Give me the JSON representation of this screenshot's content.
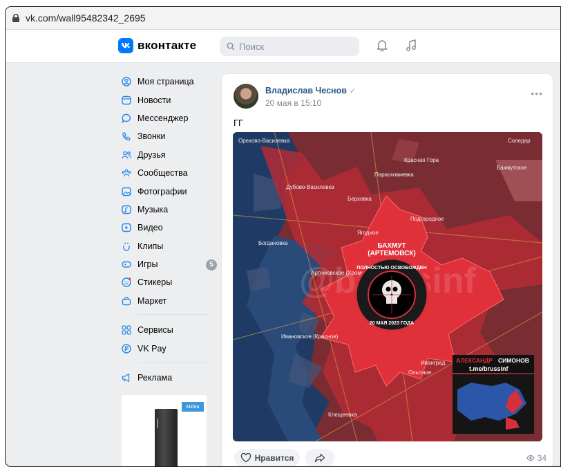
{
  "browser": {
    "url": "vk.com/wall95482342_2695"
  },
  "header": {
    "logo_text": "вконтакте",
    "search_placeholder": "Поиск"
  },
  "sidebar": {
    "items": [
      {
        "label": "Моя страница",
        "icon": "user-circle-icon"
      },
      {
        "label": "Новости",
        "icon": "news-icon"
      },
      {
        "label": "Мессенджер",
        "icon": "message-icon"
      },
      {
        "label": "Звонки",
        "icon": "phone-icon"
      },
      {
        "label": "Друзья",
        "icon": "friends-icon"
      },
      {
        "label": "Сообщества",
        "icon": "communities-icon"
      },
      {
        "label": "Фотографии",
        "icon": "photo-icon"
      },
      {
        "label": "Музыка",
        "icon": "music-icon"
      },
      {
        "label": "Видео",
        "icon": "video-icon"
      },
      {
        "label": "Клипы",
        "icon": "clips-icon"
      },
      {
        "label": "Игры",
        "icon": "games-icon",
        "badge": "5"
      },
      {
        "label": "Стикеры",
        "icon": "stickers-icon"
      },
      {
        "label": "Маркет",
        "icon": "market-icon"
      }
    ],
    "items2": [
      {
        "label": "Сервисы",
        "icon": "services-icon"
      },
      {
        "label": "VK Pay",
        "icon": "vkpay-icon"
      }
    ],
    "items3": [
      {
        "label": "Реклама",
        "icon": "ads-icon"
      }
    ],
    "ad_brand": "Midea"
  },
  "post": {
    "author": "Владислав Чеснов",
    "date": "20 мая в 15:10",
    "text": "ГГ",
    "like_label": "Нравится",
    "views": "34",
    "map": {
      "city_title_1": "БАХМУТ",
      "city_title_2": "(АРТЕМОВСК)",
      "seal_top": "ПОЛНОСТЬЮ ОСВОБОЖДЕН",
      "seal_bottom": "20 МАЯ 2023 ГОДА",
      "watermark": "@brussinf",
      "author_banner_1": "АЛЕКСАНДР",
      "author_banner_2": "СИМОНОВ",
      "telegram": "t.me/brussinf",
      "places": [
        "Орехово-Василевка",
        "Соледар",
        "Красная Гора",
        "Парасковиевка",
        "Бахмутское",
        "Дубово-Василевка",
        "Берхoвка",
        "Подгородное",
        "Ягодное",
        "Богдановка",
        "Артемовское (Хромово)",
        "Ивановское (Красное)",
        "Иванград",
        "Опытное",
        "Клещеевка"
      ]
    }
  },
  "colors": {
    "accent": "#0077ff",
    "link": "#2a5885",
    "russia_red": "#c8313a",
    "ukraine_blue": "#1f3a6b"
  }
}
